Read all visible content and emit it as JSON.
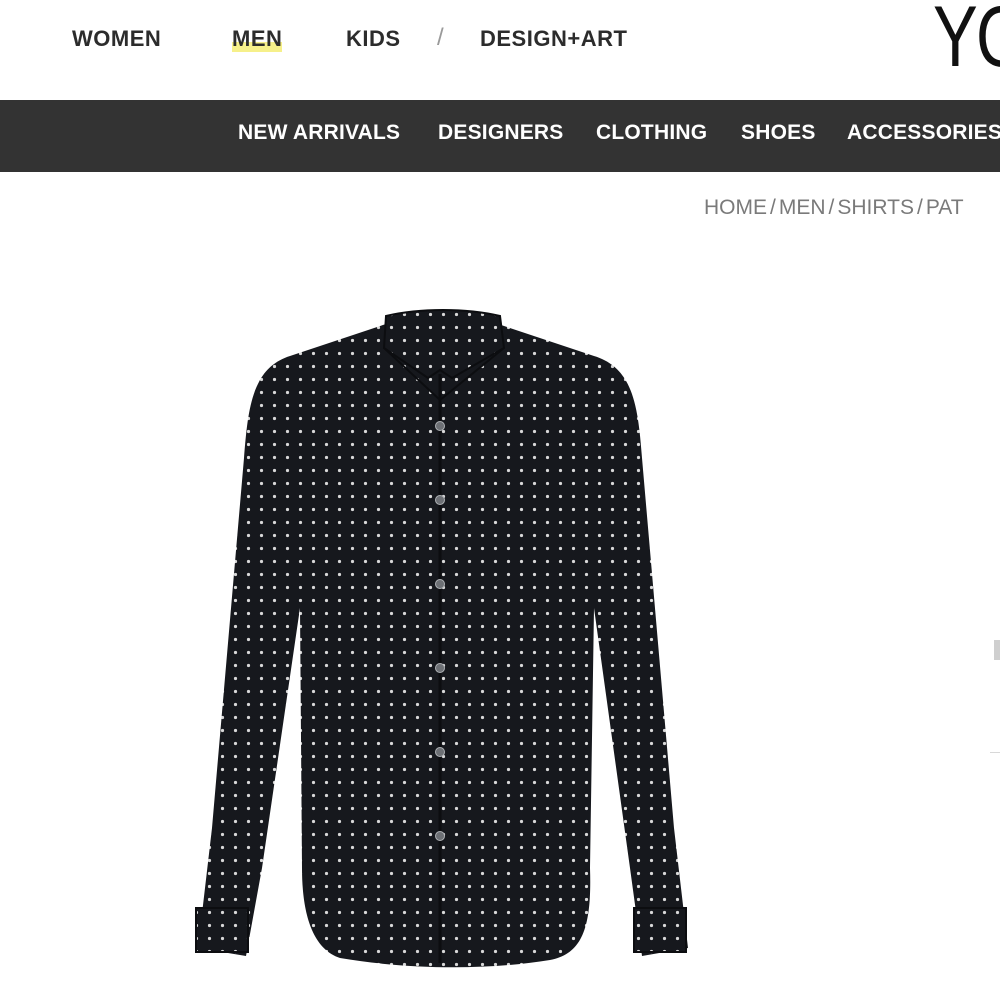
{
  "top_nav": {
    "items": [
      "WOMEN",
      "MEN",
      "KIDS",
      "DESIGN+ART"
    ],
    "active": "MEN",
    "separator": "/"
  },
  "logo": {
    "text": "YO"
  },
  "category_bar": {
    "items": [
      "NEW ARRIVALS",
      "DESIGNERS",
      "CLOTHING",
      "SHOES",
      "ACCESSORIES"
    ]
  },
  "breadcrumb": {
    "items": [
      "HOME",
      "MEN",
      "SHIRTS",
      "PAT"
    ],
    "separator": "/"
  },
  "product": {
    "image_icon": "patterned-shirt",
    "colors": {
      "fabric": "#16181d",
      "dots": "#d8d8d8",
      "buttons": "#6d7075"
    }
  },
  "colors": {
    "category_bar_bg": "#333333",
    "active_highlight": "#f6f08a",
    "nav_text": "#2c2c2c",
    "breadcrumb_text": "#7a7a7a"
  }
}
